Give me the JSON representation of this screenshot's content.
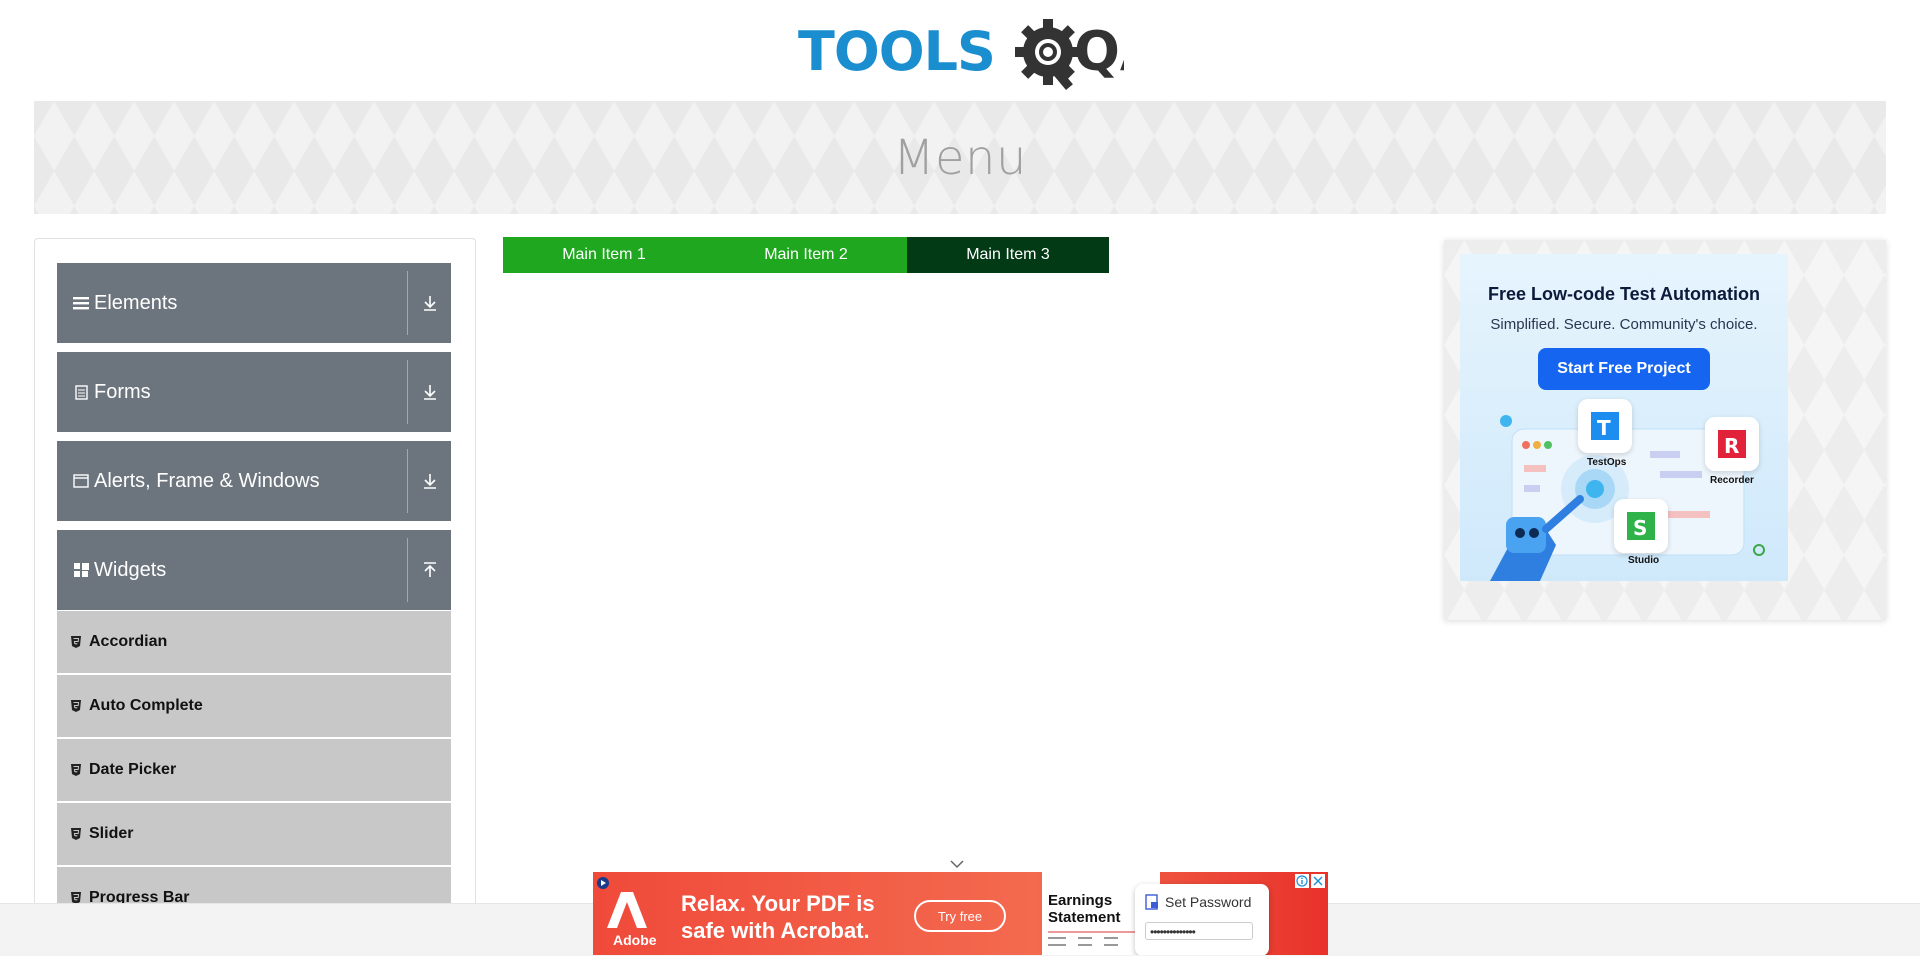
{
  "logo": {
    "text_left": "TOOLS",
    "text_right": "QA"
  },
  "banner": {
    "title": "Menu"
  },
  "sidebar": {
    "groups": [
      {
        "title": "Elements",
        "icon": "hamburger-icon",
        "expanded": false
      },
      {
        "title": "Forms",
        "icon": "document-icon",
        "expanded": false
      },
      {
        "title": "Alerts, Frame & Windows",
        "icon": "window-icon",
        "expanded": false
      },
      {
        "title": "Widgets",
        "icon": "widgets-icon",
        "expanded": true
      }
    ],
    "widget_items": [
      "Accordian",
      "Auto Complete",
      "Date Picker",
      "Slider",
      "Progress Bar"
    ]
  },
  "menu": {
    "items": [
      "Main Item 1",
      "Main Item 2",
      "Main Item 3"
    ],
    "colors": {
      "normal": "#1fa81f",
      "active": "#033a16"
    }
  },
  "right_ad": {
    "title": "Free Low-code Test Automation",
    "subtitle": "Simplified. Secure. Community's choice.",
    "button": "Start Free Project",
    "products": [
      "TestOps",
      "Recorder",
      "Studio"
    ]
  },
  "bottom_ad": {
    "brand": "Adobe",
    "headline": "Relax. Your PDF is safe with Acrobat.",
    "cta": "Try free",
    "doc_title": "Earnings Statement",
    "password_label": "Set Password",
    "password_value": "••••••••••••••"
  }
}
